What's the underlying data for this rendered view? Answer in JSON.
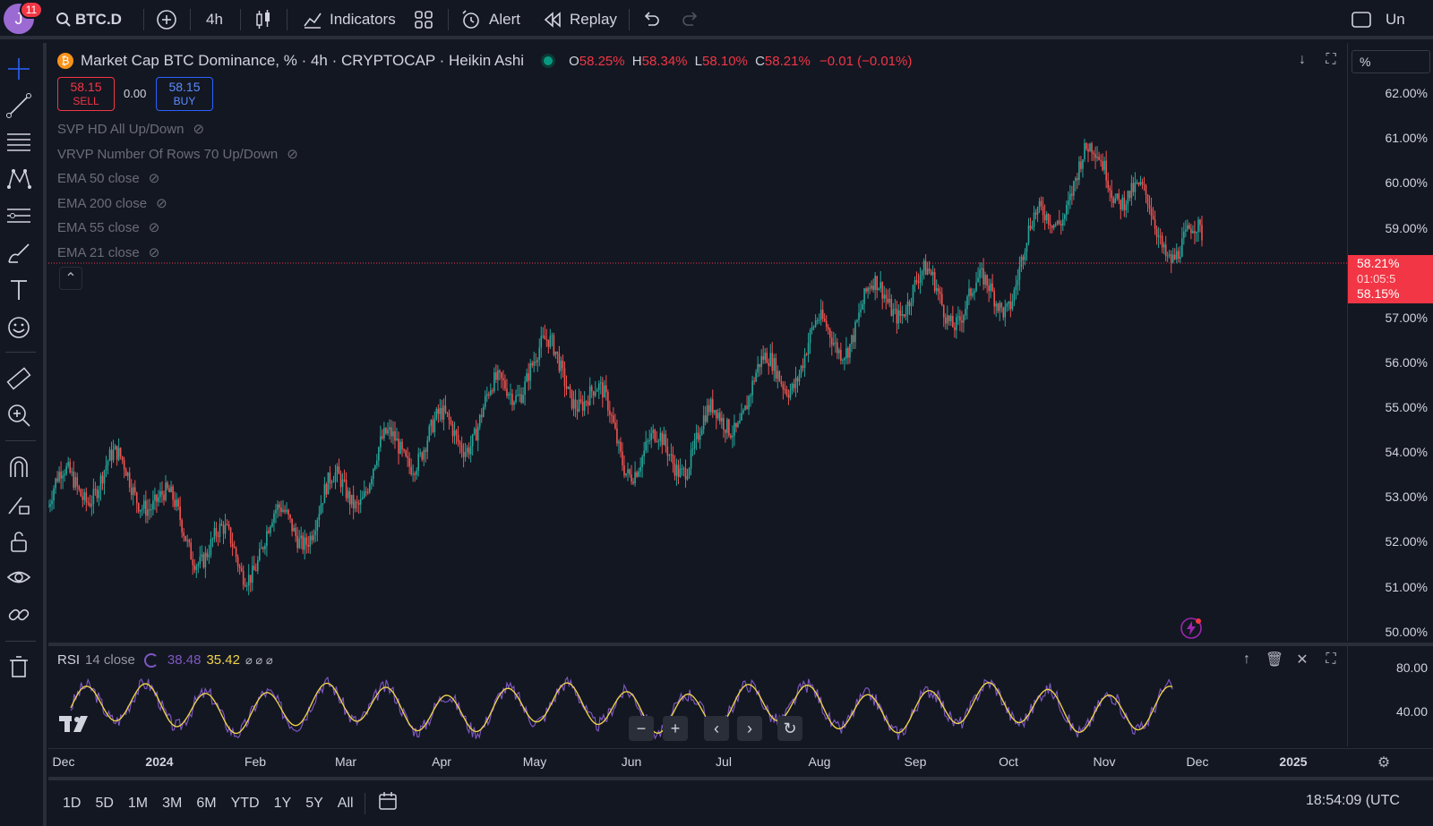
{
  "topbar": {
    "avatar_letter": "J",
    "notification_count": "11",
    "symbol": "BTC.D",
    "interval": "4h",
    "indicators_label": "Indicators",
    "alert_label": "Alert",
    "replay_label": "Replay",
    "right_label": "Un"
  },
  "legend": {
    "title": "Market Cap BTC Dominance, % · 4h · CRYPTOCAP · Heikin Ashi",
    "o_label": "O",
    "o_value": "58.25%",
    "h_label": "H",
    "h_value": "58.34%",
    "l_label": "L",
    "l_value": "58.10%",
    "c_label": "C",
    "c_value": "58.21%",
    "change": "−0.01 (−0.01%)"
  },
  "trade": {
    "sell_price": "58.15",
    "sell_label": "SELL",
    "spread": "0.00",
    "buy_price": "58.15",
    "buy_label": "BUY"
  },
  "indicators": [
    "SVP HD All Up/Down",
    "VRVP Number Of Rows 70 Up/Down",
    "EMA 50 close",
    "EMA 200 close",
    "EMA 55 close",
    "EMA 21 close"
  ],
  "price_scale": {
    "unit_label": "%",
    "ticks": [
      "62.00%",
      "61.00%",
      "60.00%",
      "59.00%",
      "57.00%",
      "56.00%",
      "55.00%",
      "54.00%",
      "53.00%",
      "52.00%",
      "51.00%",
      "50.00%"
    ],
    "current_price": "58.21%",
    "countdown": "01:05:5",
    "bid_price": "58.15%"
  },
  "rsi": {
    "label": "RSI",
    "params": "14 close",
    "value1": "38.48",
    "value2": "35.42",
    "ticks": [
      "80.00",
      "40.00"
    ]
  },
  "time_axis": [
    "Dec",
    "2024",
    "Feb",
    "Mar",
    "Apr",
    "May",
    "Jun",
    "Jul",
    "Aug",
    "Sep",
    "Oct",
    "Nov",
    "Dec",
    "2025"
  ],
  "bottombar": {
    "ranges": [
      "1D",
      "5D",
      "1M",
      "3M",
      "6M",
      "YTD",
      "1Y",
      "5Y",
      "All"
    ],
    "clock": "18:54:09 (UTC"
  },
  "colors": {
    "up": "#26a69a",
    "down": "#ef5350",
    "rsi": "#7e57c2",
    "rsi_ma": "#f0d34a",
    "bg": "#131722"
  },
  "chart_data": {
    "type": "line",
    "series_kind": "heikin-ashi candles (approximate closes)",
    "x": [
      "Dec",
      "2024",
      "Feb",
      "Mar",
      "Apr",
      "May",
      "Jun",
      "Jul",
      "Aug",
      "Sep",
      "Oct",
      "Nov",
      "Dec"
    ],
    "series": [
      {
        "values": [
          52.8,
          53.5,
          51.2,
          53.4,
          54.0,
          56.2,
          54.2,
          54.3,
          56.8,
          57.3,
          57.9,
          60.6,
          58.2
        ]
      }
    ],
    "ylim": [
      50,
      62.5
    ],
    "ylabel": "%"
  }
}
